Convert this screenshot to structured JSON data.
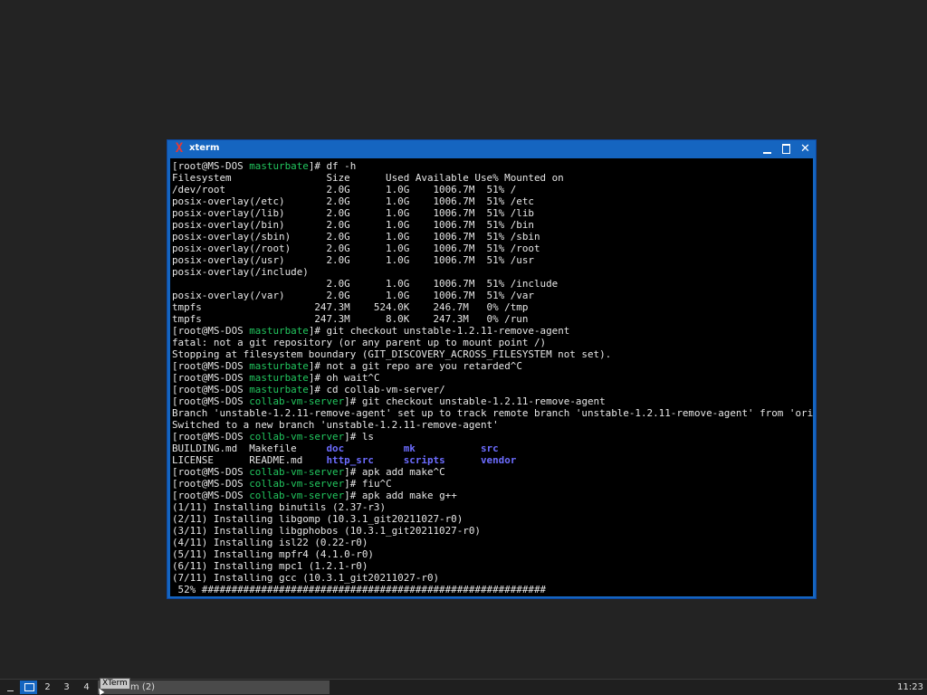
{
  "window": {
    "title": "xterm",
    "app_icon": "X",
    "icons": {
      "app": "xterm-icon",
      "minimize": "minimize-icon",
      "maximize": "maximize-icon",
      "close": "close-icon"
    },
    "close_glyph": "✕"
  },
  "colors": {
    "titlebar": "#1565c0",
    "terminal_bg": "#000000",
    "terminal_fg": "#e6e6e6",
    "prompt_dir": "#22c55e",
    "ls_dir": "#6c6cff",
    "desktop": "#232323"
  },
  "terminal": {
    "lines": [
      [
        {
          "t": "["
        },
        {
          "t": "root@MS-DOS"
        },
        {
          "t": " "
        },
        {
          "t": "masturbate",
          "c": "green"
        },
        {
          "t": "]# df -h"
        }
      ],
      [
        {
          "t": "Filesystem                Size      Used Available Use% Mounted on"
        }
      ],
      [
        {
          "t": "/dev/root                 2.0G      1.0G    1006.7M  51% /"
        }
      ],
      [
        {
          "t": "posix-overlay(/etc)       2.0G      1.0G    1006.7M  51% /etc"
        }
      ],
      [
        {
          "t": "posix-overlay(/lib)       2.0G      1.0G    1006.7M  51% /lib"
        }
      ],
      [
        {
          "t": "posix-overlay(/bin)       2.0G      1.0G    1006.7M  51% /bin"
        }
      ],
      [
        {
          "t": "posix-overlay(/sbin)      2.0G      1.0G    1006.7M  51% /sbin"
        }
      ],
      [
        {
          "t": "posix-overlay(/root)      2.0G      1.0G    1006.7M  51% /root"
        }
      ],
      [
        {
          "t": "posix-overlay(/usr)       2.0G      1.0G    1006.7M  51% /usr"
        }
      ],
      [
        {
          "t": "posix-overlay(/include)"
        }
      ],
      [
        {
          "t": "                          2.0G      1.0G    1006.7M  51% /include"
        }
      ],
      [
        {
          "t": "posix-overlay(/var)       2.0G      1.0G    1006.7M  51% /var"
        }
      ],
      [
        {
          "t": "tmpfs                   247.3M    524.0K    246.7M   0% /tmp"
        }
      ],
      [
        {
          "t": "tmpfs                   247.3M      8.0K    247.3M   0% /run"
        }
      ],
      [
        {
          "t": "["
        },
        {
          "t": "root@MS-DOS"
        },
        {
          "t": " "
        },
        {
          "t": "masturbate",
          "c": "green"
        },
        {
          "t": "]# git checkout unstable-1.2.11-remove-agent"
        }
      ],
      [
        {
          "t": "fatal: not a git repository (or any parent up to mount point /)"
        }
      ],
      [
        {
          "t": "Stopping at filesystem boundary (GIT_DISCOVERY_ACROSS_FILESYSTEM not set)."
        }
      ],
      [
        {
          "t": "["
        },
        {
          "t": "root@MS-DOS"
        },
        {
          "t": " "
        },
        {
          "t": "masturbate",
          "c": "green"
        },
        {
          "t": "]# not a git repo are you retarded^C"
        }
      ],
      [
        {
          "t": "["
        },
        {
          "t": "root@MS-DOS"
        },
        {
          "t": " "
        },
        {
          "t": "masturbate",
          "c": "green"
        },
        {
          "t": "]# oh wait^C"
        }
      ],
      [
        {
          "t": "["
        },
        {
          "t": "root@MS-DOS"
        },
        {
          "t": " "
        },
        {
          "t": "masturbate",
          "c": "green"
        },
        {
          "t": "]# cd collab-vm-server/"
        }
      ],
      [
        {
          "t": "["
        },
        {
          "t": "root@MS-DOS"
        },
        {
          "t": " "
        },
        {
          "t": "collab-vm-server",
          "c": "green"
        },
        {
          "t": "]# git checkout unstable-1.2.11-remove-agent"
        }
      ],
      [
        {
          "t": "Branch 'unstable-1.2.11-remove-agent' set up to track remote branch 'unstable-1.2.11-remove-agent' from 'origin'."
        }
      ],
      [
        {
          "t": "Switched to a new branch 'unstable-1.2.11-remove-agent'"
        }
      ],
      [
        {
          "t": "["
        },
        {
          "t": "root@MS-DOS"
        },
        {
          "t": " "
        },
        {
          "t": "collab-vm-server",
          "c": "green"
        },
        {
          "t": "]# ls"
        }
      ],
      [
        {
          "t": "BUILDING.md  Makefile     "
        },
        {
          "t": "doc",
          "c": "blue"
        },
        {
          "t": "          "
        },
        {
          "t": "mk",
          "c": "blue"
        },
        {
          "t": "           "
        },
        {
          "t": "src",
          "c": "blue"
        }
      ],
      [
        {
          "t": "LICENSE      README.md    "
        },
        {
          "t": "http_src",
          "c": "blue"
        },
        {
          "t": "     "
        },
        {
          "t": "scripts",
          "c": "blue"
        },
        {
          "t": "      "
        },
        {
          "t": "vendor",
          "c": "blue"
        }
      ],
      [
        {
          "t": "["
        },
        {
          "t": "root@MS-DOS"
        },
        {
          "t": " "
        },
        {
          "t": "collab-vm-server",
          "c": "green"
        },
        {
          "t": "]# apk add make^C"
        }
      ],
      [
        {
          "t": "["
        },
        {
          "t": "root@MS-DOS"
        },
        {
          "t": " "
        },
        {
          "t": "collab-vm-server",
          "c": "green"
        },
        {
          "t": "]# fiu^C"
        }
      ],
      [
        {
          "t": "["
        },
        {
          "t": "root@MS-DOS"
        },
        {
          "t": " "
        },
        {
          "t": "collab-vm-server",
          "c": "green"
        },
        {
          "t": "]# apk add make g++"
        }
      ],
      [
        {
          "t": "(1/11) Installing binutils (2.37-r3)"
        }
      ],
      [
        {
          "t": "(2/11) Installing libgomp (10.3.1_git20211027-r0)"
        }
      ],
      [
        {
          "t": "(3/11) Installing libgphobos (10.3.1_git20211027-r0)"
        }
      ],
      [
        {
          "t": "(4/11) Installing isl22 (0.22-r0)"
        }
      ],
      [
        {
          "t": "(5/11) Installing mpfr4 (4.1.0-r0)"
        }
      ],
      [
        {
          "t": "(6/11) Installing mpc1 (1.2.1-r0)"
        }
      ],
      [
        {
          "t": "(7/11) Installing gcc (10.3.1_git20211027-r0)"
        }
      ],
      [
        {
          "t": " 52% ##########################################################"
        }
      ]
    ]
  },
  "taskbar": {
    "menu_icon": "menu-icon",
    "workspaces": [
      "1",
      "2",
      "3",
      "4"
    ],
    "active_workspace": "1",
    "task_label": "m (2)",
    "tooltip": "XTerm",
    "clock": "11:23"
  }
}
